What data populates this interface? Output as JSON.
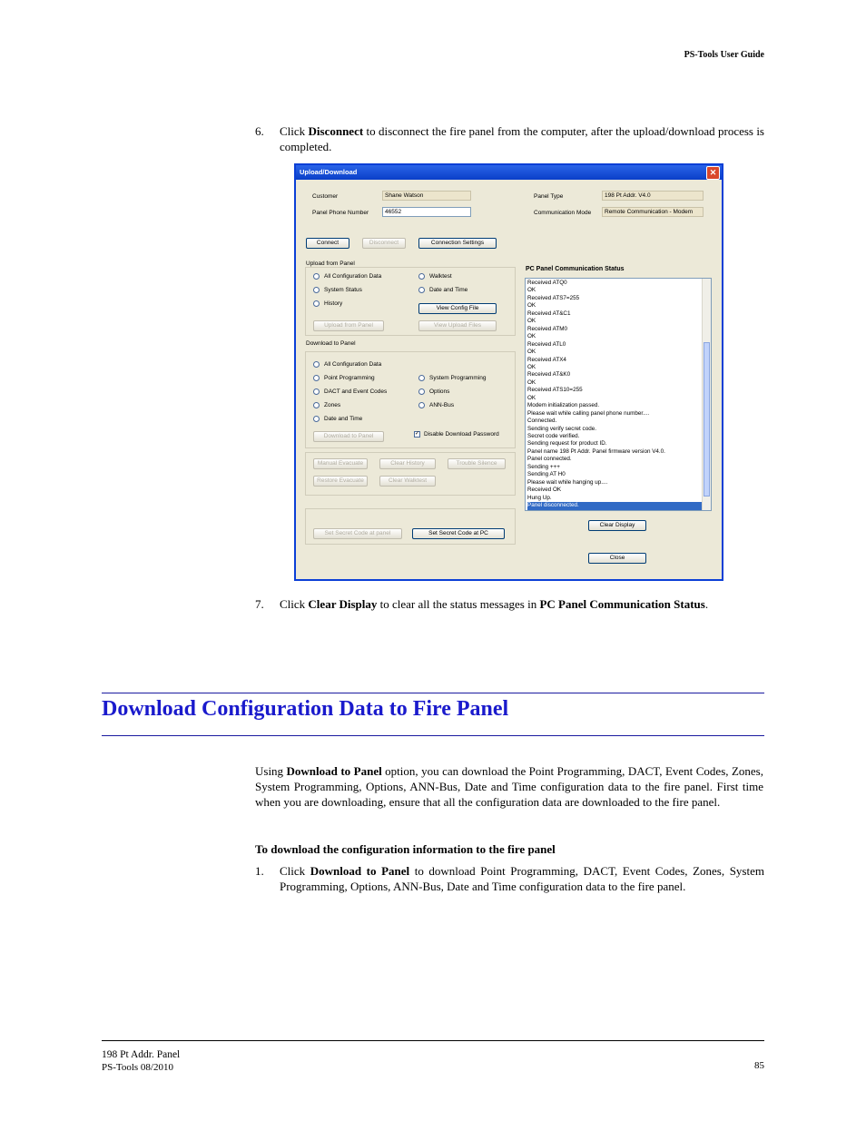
{
  "header": {
    "title": "PS-Tools User Guide"
  },
  "steps": {
    "s6_num": "6.",
    "s6_pre": "Click ",
    "s6_bold": "Disconnect",
    "s6_post": " to disconnect the fire panel from the computer, after the upload/download process is completed.",
    "s7_num": "7.",
    "s7_pre": "Click ",
    "s7_bold1": "Clear Display",
    "s7_mid": " to clear all the status messages in ",
    "s7_bold2": "PC Panel Communication Status",
    "s7_post": "."
  },
  "dialog": {
    "title": "Upload/Download",
    "close_glyph": "✕",
    "customer_label": "Customer",
    "customer_value": "Shane Watson",
    "phone_label": "Panel Phone Number",
    "phone_value": "46552",
    "panel_type_label": "Panel Type",
    "panel_type_value": "198 Pt Addr. V4.0",
    "comm_mode_label": "Communication Mode",
    "comm_mode_value": "Remote Communication - Modem",
    "connect": "Connect",
    "disconnect": "Disconnect",
    "connection_settings": "Connection Settings",
    "upload_group": "Upload from Panel",
    "up_all": "All Configuration Data",
    "up_walktest": "Walktest",
    "up_system_status": "System Status",
    "up_date_time": "Date and Time",
    "up_history": "History",
    "view_config": "View Config File",
    "upload_from_panel": "Upload from Panel",
    "view_upload_files": "View Upload Files",
    "download_group": "Download to Panel",
    "dn_all": "All Configuration Data",
    "dn_point": "Point Programming",
    "dn_system": "System Programming",
    "dn_dact": "DACT and Event Codes",
    "dn_options": "Options",
    "dn_zones": "Zones",
    "dn_ann": "ANN-Bus",
    "dn_date": "Date and Time",
    "download_to_panel": "Download to Panel",
    "disable_pw": "Disable Download Password",
    "manual_evacuate": "Manual Evacuate",
    "clear_history": "Clear History",
    "trouble_silence": "Trouble Silence",
    "restore_evacuate": "Restore Evacuate",
    "clear_walktest": "Clear Walktest",
    "set_secret_panel": "Set Secret Code at panel",
    "set_secret_pc": "Set Secret Code at PC",
    "status_title": "PC Panel Communication Status",
    "status_lines": [
      "Received ATQ0",
      "OK",
      "Received ATS7=255",
      "OK",
      "Received AT&C1",
      "OK",
      "Received ATM0",
      "OK",
      "Received ATL0",
      "OK",
      "Received ATX4",
      "OK",
      "Received AT&K0",
      "OK",
      "Received ATS10=255",
      "OK",
      "Modem initialization passed.",
      "Please wait while calling panel phone number....",
      "Connected.",
      "Sending verify secret code.",
      "Secret code verified.",
      "Sending request for product ID.",
      "Panel name 198 Pt Addr. Panel firmware version V4.0.",
      "Panel connected.",
      "Sending +++",
      "Sending AT H0",
      "Please wait while hanging up....",
      "Received    OK",
      "Hung Up.",
      "Panel disconnected."
    ],
    "clear_display": "Clear Display",
    "close": "Close"
  },
  "section": {
    "heading": "Download Configuration Data to Fire Panel",
    "p1_pre": "Using ",
    "p1_bold": "Download to Panel",
    "p1_post": " option, you can download the Point Programming, DACT, Event Codes, Zones, System Programming, Options, ANN-Bus, Date and Time configuration data to the fire panel. First time when you are downloading, ensure that all the configuration data are downloaded to the fire panel.",
    "subheading": "To download the configuration information to the fire panel",
    "s1_num": "1.",
    "s1_pre": "Click ",
    "s1_bold": "Download to Panel",
    "s1_post": " to download Point Programming, DACT, Event Codes, Zones, System Programming, Options, ANN-Bus, Date and Time configuration data to the fire panel."
  },
  "footer": {
    "product": "198 Pt Addr. Panel",
    "doc": "PS-Tools  08/2010",
    "page": "85"
  }
}
